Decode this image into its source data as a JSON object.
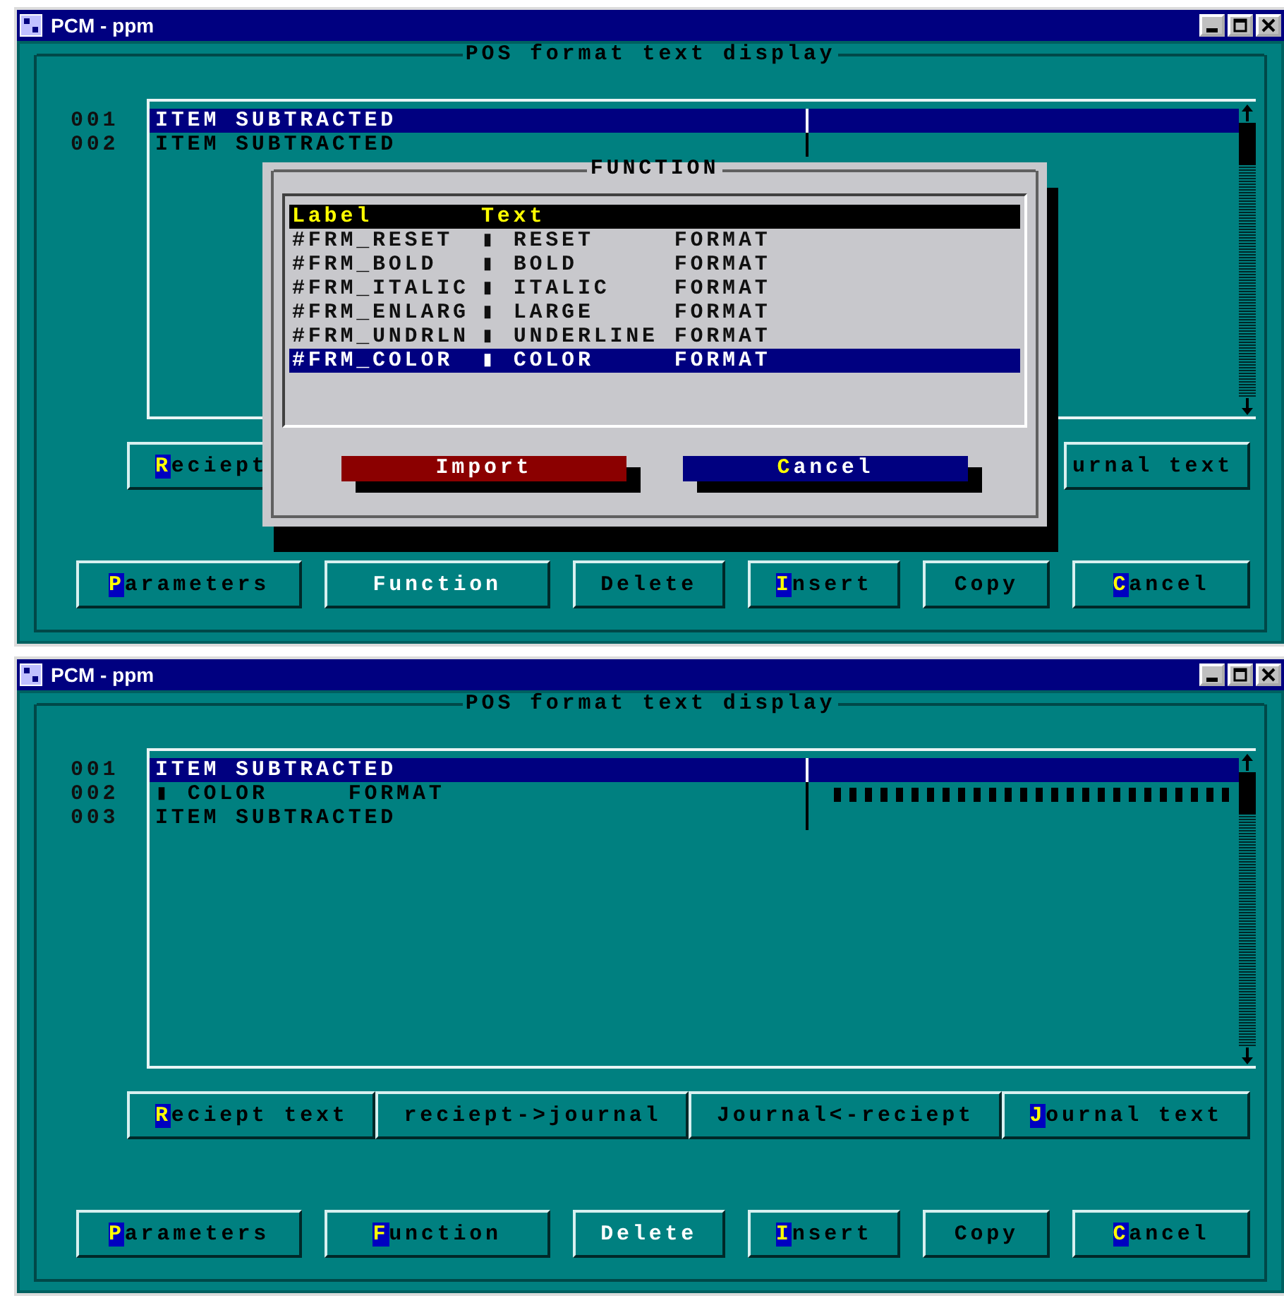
{
  "windows": [
    {
      "title": "PCM - ppm",
      "frame_title": "POS format text display",
      "rows": [
        {
          "number": "001",
          "text": "ITEM SUBTRACTED",
          "kind": "text",
          "selected": true
        },
        {
          "number": "002",
          "text": "ITEM SUBTRACTED",
          "kind": "text",
          "selected": false
        }
      ],
      "button_rows": [
        [
          {
            "label": "Reciept",
            "hotkey": true,
            "focused": false
          },
          {
            "label": "urnal text",
            "hotkey": false,
            "focused": false
          }
        ],
        [
          {
            "label": "Parameters",
            "hotkey": true,
            "focused": false
          },
          {
            "label": "Function",
            "hotkey": false,
            "focused": true
          },
          {
            "label": "Delete",
            "hotkey": false,
            "focused": false
          },
          {
            "label": "Insert",
            "hotkey": true,
            "focused": false
          },
          {
            "label": "Copy",
            "hotkey": false,
            "focused": false
          },
          {
            "label": "Cancel",
            "hotkey": true,
            "focused": false
          }
        ]
      ],
      "dialog": {
        "title": "FUNCTION",
        "columns": [
          "Label",
          "Text"
        ],
        "rows": [
          {
            "label": "#FRM_RESET",
            "text": "▮ RESET     FORMAT",
            "selected": false
          },
          {
            "label": "#FRM_BOLD",
            "text": "▮ BOLD      FORMAT",
            "selected": false
          },
          {
            "label": "#FRM_ITALIC",
            "text": "▮ ITALIC    FORMAT",
            "selected": false
          },
          {
            "label": "#FRM_ENLARG",
            "text": "▮ LARGE     FORMAT",
            "selected": false
          },
          {
            "label": "#FRM_UNDRLN",
            "text": "▮ UNDERLINE FORMAT",
            "selected": false
          },
          {
            "label": "#FRM_COLOR",
            "text": "▮ COLOR     FORMAT",
            "selected": true
          }
        ],
        "buttons": [
          {
            "label": "Import",
            "hotkey": false,
            "color": "#8b0000"
          },
          {
            "label": "Cancel",
            "hotkey": true,
            "color": "#000080"
          }
        ]
      }
    },
    {
      "title": "PCM - ppm",
      "frame_title": "POS format text display",
      "rows": [
        {
          "number": "001",
          "text": "ITEM SUBTRACTED",
          "kind": "text",
          "selected": true
        },
        {
          "number": "002",
          "text": "▮ COLOR     FORMAT",
          "kind": "format",
          "selected": false
        },
        {
          "number": "003",
          "text": "ITEM SUBTRACTED",
          "kind": "text",
          "selected": false
        }
      ],
      "button_rows": [
        [
          {
            "label": "Reciept text",
            "hotkey": true,
            "focused": false
          },
          {
            "label": "reciept->journal",
            "hotkey": false,
            "focused": false
          },
          {
            "label": "Journal<-reciept",
            "hotkey": false,
            "focused": false
          },
          {
            "label": "Journal text",
            "hotkey": true,
            "focused": false
          }
        ],
        [
          {
            "label": "Parameters",
            "hotkey": true,
            "focused": false
          },
          {
            "label": "Function",
            "hotkey": true,
            "focused": false
          },
          {
            "label": "Delete",
            "hotkey": false,
            "focused": true
          },
          {
            "label": "Insert",
            "hotkey": true,
            "focused": false
          },
          {
            "label": "Copy",
            "hotkey": false,
            "focused": false
          },
          {
            "label": "Cancel",
            "hotkey": true,
            "focused": false
          }
        ]
      ]
    }
  ]
}
